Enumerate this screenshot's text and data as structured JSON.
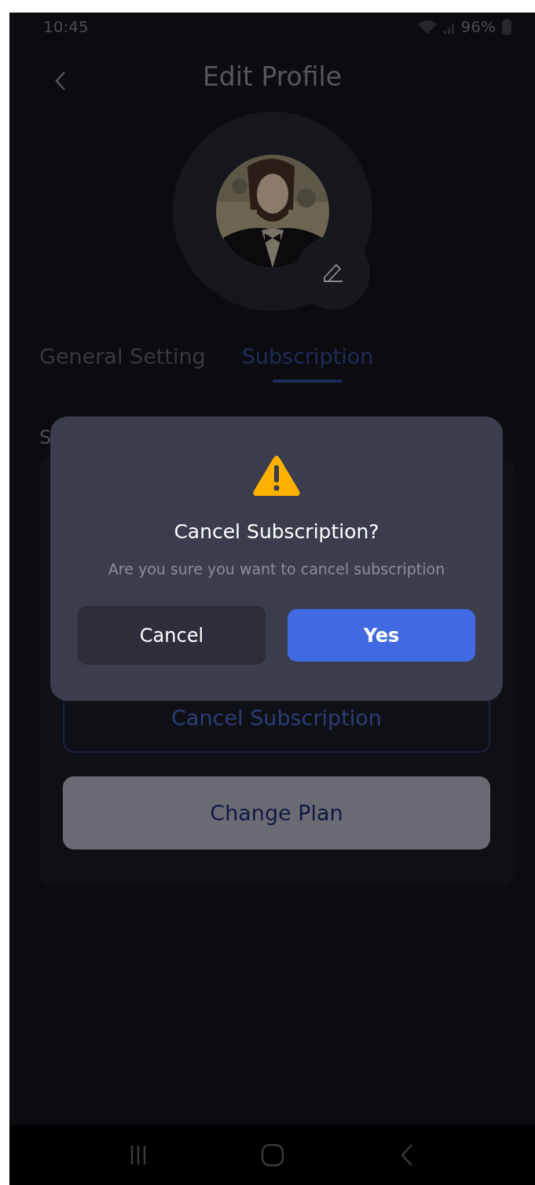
{
  "status_bar": {
    "time": "10:45",
    "battery": "96%"
  },
  "header": {
    "title": "Edit Profile"
  },
  "tabs": [
    {
      "label": "General Setting",
      "selected": false
    },
    {
      "label": "Subscription",
      "selected": true
    }
  ],
  "section": {
    "title": "S"
  },
  "actions": [
    {
      "label": "Cancel Subscription",
      "kind": "outline"
    },
    {
      "label": "Change Plan",
      "kind": "filled"
    }
  ],
  "dialog": {
    "title": "Cancel Subscription?",
    "message": "Are you sure you want to cancel subscription",
    "buttons": [
      {
        "label": "Cancel",
        "kind": "secondary"
      },
      {
        "label": "Yes",
        "kind": "primary"
      }
    ]
  }
}
